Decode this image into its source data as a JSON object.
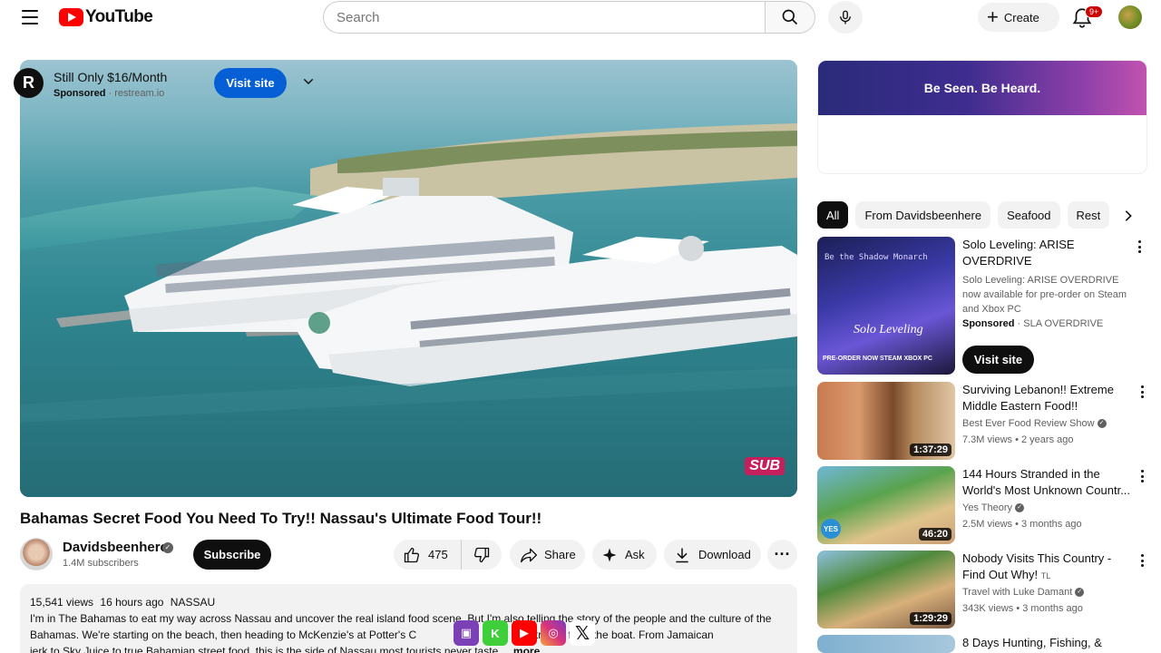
{
  "header": {
    "logo_text": "YouTube",
    "search_placeholder": "Search",
    "create_label": "Create",
    "notification_count": "9+"
  },
  "player": {
    "sub_badge": "SUB"
  },
  "video": {
    "title": "Bahamas Secret Food You Need To Try!! Nassau's Ultimate Food Tour!!",
    "channel_name": "Davidsbeenhere",
    "subscribers": "1.4M subscribers",
    "subscribe_label": "Subscribe",
    "likes": "475",
    "share_label": "Share",
    "ask_label": "Ask",
    "download_label": "Download",
    "views": "15,541 views",
    "posted": "16 hours ago",
    "location": "NASSAU",
    "description": "I'm in The Bahamas to eat my way across Nassau and uncover the real island food scene. But I'm also telling the story of the people and the culture of the Bahamas. We're starting on the beach, then heading to McKenzie's at Potter's C",
    "description_mid": "straight from the boat. From Jamaican",
    "description_end": "jerk to Sky Juice to true Bahamian street food, this is the side of Nassau most tourists never taste.",
    "more_label": "...more"
  },
  "ad": {
    "banner_text": "Be Seen. Be Heard.",
    "logo_letter": "R",
    "title": "Still Only $16/Month",
    "sponsored": "Sponsored",
    "domain": "restream.io",
    "visit_label": "Visit site"
  },
  "chips": [
    "All",
    "From Davidsbeenhere",
    "Seafood",
    "Rest"
  ],
  "recommendations": [
    {
      "title": "Solo Leveling: ARISE OVERDRIVE",
      "desc": "Solo Leveling: ARISE OVERDRIVE now available for pre-order on Steam and Xbox PC",
      "sponsored": "Sponsored",
      "advertiser": "SLA OVERDRIVE",
      "visit_label": "Visit site",
      "thumb_caption": "Be the Shadow Monarch",
      "thumb_logo": "Solo Leveling",
      "thumb_footer": "PRE-ORDER NOW  STEAM  XBOX PC"
    },
    {
      "title": "Surviving Lebanon!! Extreme Middle Eastern Food!!",
      "channel": "Best Ever Food Review Show",
      "views": "7.3M views",
      "age": "2 years ago",
      "duration": "1:37:29"
    },
    {
      "title": "144 Hours Stranded in the World's Most Unknown Countr...",
      "channel": "Yes Theory",
      "views": "2.5M views",
      "age": "3 months ago",
      "duration": "46:20",
      "thumb_badge": "YES"
    },
    {
      "title": "Nobody Visits This Country - Find Out Why!",
      "title_suffix": "TL",
      "channel": "Travel with Luke Damant",
      "views": "343K views",
      "age": "3 months ago",
      "duration": "1:29:29"
    },
    {
      "title": "8 Days Hunting, Fishing, &"
    }
  ],
  "colors": {
    "brand_red": "#ff0000",
    "accent_blue": "#065fd4",
    "sub_badge": "#c51f5d"
  }
}
